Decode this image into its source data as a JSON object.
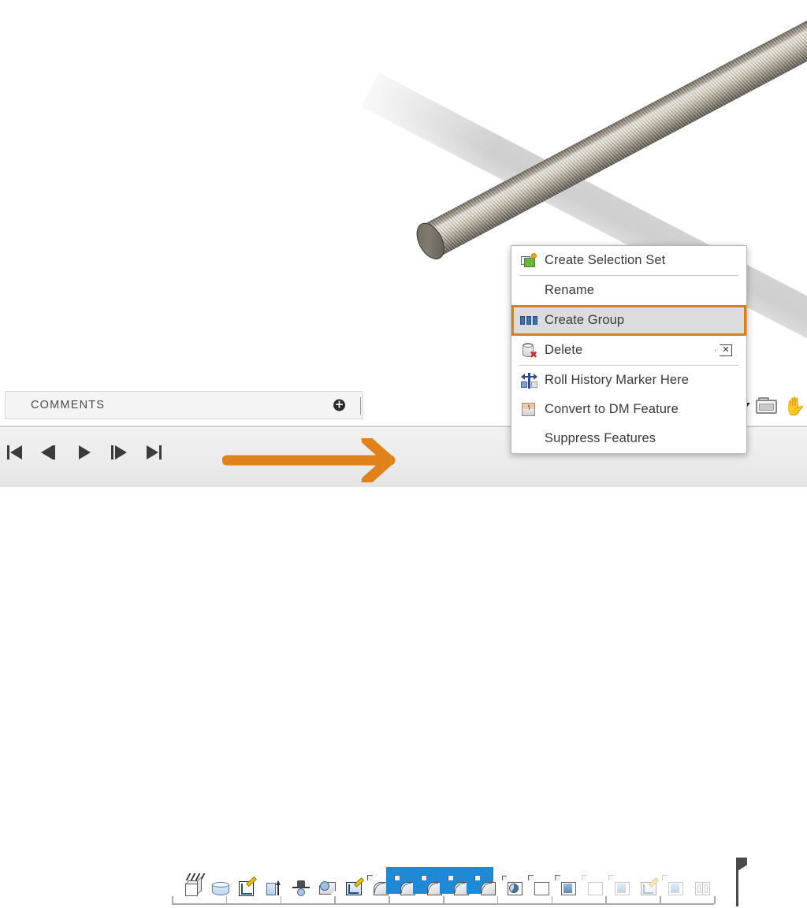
{
  "app": {
    "kind": "cad-modeling-application",
    "accent_orange": "#e0821c",
    "highlight_border": "#d4811f",
    "selection_blue": "#1e8ad6"
  },
  "viewport": {
    "name": "graphics-viewport",
    "model": "threaded-rod",
    "background": "#ffffff"
  },
  "context_menu": {
    "items": [
      {
        "label": "Create Selection Set",
        "icon": "create-selection-set-icon",
        "shortcut": "",
        "highlighted": false,
        "separator_after": true
      },
      {
        "label": "Rename",
        "icon": "",
        "shortcut": "",
        "highlighted": false,
        "separator_after": false
      },
      {
        "label": "Create Group",
        "icon": "create-group-icon",
        "shortcut": "",
        "highlighted": true,
        "separator_after": false
      },
      {
        "label": "Delete",
        "icon": "delete-icon",
        "shortcut": "backspace-key-icon",
        "highlighted": false,
        "separator_after": true
      },
      {
        "label": "Roll History Marker Here",
        "icon": "roll-history-marker-icon",
        "shortcut": "",
        "highlighted": false,
        "separator_after": false
      },
      {
        "label": "Convert to DM Feature",
        "icon": "convert-to-dm-feature-icon",
        "shortcut": "",
        "highlighted": false,
        "separator_after": false
      },
      {
        "label": "Suppress Features",
        "icon": "",
        "shortcut": "",
        "highlighted": false,
        "separator_after": false
      }
    ]
  },
  "comments_panel": {
    "title": "COMMENTS",
    "add_button_label": "+"
  },
  "playback": {
    "buttons": [
      {
        "name": "skip-to-start-button",
        "glyph": "skip-start"
      },
      {
        "name": "step-backward-button",
        "glyph": "step-back"
      },
      {
        "name": "play-button",
        "glyph": "play"
      },
      {
        "name": "step-forward-button",
        "glyph": "step-forward"
      },
      {
        "name": "skip-to-end-button",
        "glyph": "skip-end"
      }
    ]
  },
  "feature_timeline": {
    "features": [
      {
        "name": "origin-cube-feature",
        "glyph": "cube",
        "selected": false,
        "faded": false
      },
      {
        "name": "cylinder-feature",
        "glyph": "cylinder",
        "selected": false,
        "faded": false
      },
      {
        "name": "sketch-feature",
        "glyph": "sketch",
        "selected": false,
        "faded": false
      },
      {
        "name": "extrude-feature",
        "glyph": "extrude",
        "selected": false,
        "faded": false
      },
      {
        "name": "revolve-feature",
        "glyph": "revolve",
        "selected": false,
        "faded": false
      },
      {
        "name": "sweep-feature",
        "glyph": "sweep",
        "selected": false,
        "faded": false
      },
      {
        "name": "sketch-2-feature",
        "glyph": "loft",
        "selected": false,
        "faded": false
      },
      {
        "name": "fillet-feature",
        "glyph": "fillet",
        "selected": false,
        "faded": false
      },
      {
        "name": "helix-feature-1",
        "glyph": "fillet",
        "selected": true,
        "faded": false
      },
      {
        "name": "helix-feature-2",
        "glyph": "fillet",
        "selected": true,
        "faded": false
      },
      {
        "name": "helix-feature-3",
        "glyph": "fillet",
        "selected": true,
        "faded": false
      },
      {
        "name": "helix-feature-4",
        "glyph": "fillet",
        "selected": true,
        "faded": false
      },
      {
        "name": "section-feature",
        "glyph": "pie",
        "selected": false,
        "faded": false
      },
      {
        "name": "part-feature-a",
        "glyph": "plain",
        "selected": false,
        "faded": false
      },
      {
        "name": "part-feature-b",
        "glyph": "part",
        "selected": false,
        "faded": false
      },
      {
        "name": "part-feature-c",
        "glyph": "plain",
        "selected": false,
        "faded": true
      },
      {
        "name": "part-feature-d",
        "glyph": "part",
        "selected": false,
        "faded": true
      },
      {
        "name": "sketch-feature-e",
        "glyph": "loft",
        "selected": false,
        "faded": true
      },
      {
        "name": "part-feature-f",
        "glyph": "part",
        "selected": false,
        "faded": true
      },
      {
        "name": "mirror-feature",
        "glyph": "mirror",
        "selected": false,
        "faded": true
      }
    ],
    "ruler_ticks": 10,
    "end_marker": "history-end-marker"
  },
  "view_controls": {
    "items": [
      {
        "name": "view-dropdown-caret",
        "glyph": "caret-down"
      },
      {
        "name": "display-state-icon",
        "glyph": "display"
      },
      {
        "name": "pan-hand-icon",
        "glyph": "hand"
      }
    ]
  },
  "annotation": {
    "arrow_color": "#e0821c",
    "arrow_points_to": "selected-helix-features",
    "highlight_target": "Create Group"
  }
}
